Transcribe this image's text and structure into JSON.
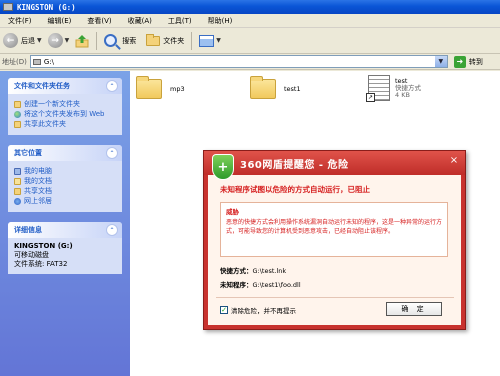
{
  "window": {
    "title": "KINGSTON (G:)"
  },
  "menu": [
    "文件(F)",
    "编辑(E)",
    "查看(V)",
    "收藏(A)",
    "工具(T)",
    "帮助(H)"
  ],
  "toolbar": {
    "back_label": "后退",
    "search_label": "搜索",
    "folders_label": "文件夹"
  },
  "address": {
    "label": "地址(D)",
    "value": "G:\\",
    "go_label": "转到"
  },
  "left_pane": {
    "file_tasks": {
      "title": "文件和文件夹任务",
      "items": [
        "创建一个新文件夹",
        "将这个文件夹发布到 Web",
        "共享此文件夹"
      ]
    },
    "other_places": {
      "title": "其它位置",
      "items": [
        "我的电脑",
        "我的文档",
        "共享文档",
        "网上邻居"
      ]
    },
    "details": {
      "title": "详细信息",
      "name": "KINGSTON (G:)",
      "type": "可移动磁盘",
      "fs": "文件系统: FAT32"
    }
  },
  "files": [
    {
      "name": "mp3",
      "kind": "folder"
    },
    {
      "name": "test1",
      "kind": "folder"
    },
    {
      "name": "test",
      "type": "快捷方式",
      "size": "4 KB",
      "kind": "shortcut"
    }
  ],
  "dialog": {
    "title": "360网盾提醒您 - 危险",
    "close": "×",
    "warning": "未知程序试图以危险的方式自动运行，已阻止",
    "threat_title": "威胁",
    "threat_desc": "恶意的快捷方式会利用操作系统漏洞自动运行未知的程序，这是一种异常的运行方式，可能导致您的计算机受到恶意攻击，已经自动阻止该程序。",
    "shortcut_label": "快捷方式：",
    "shortcut_value": "G:\\test.lnk",
    "program_label": "未知程序：",
    "program_value": "G:\\test1\\foo.dll",
    "checkbox_label": "清除危险，并不再提示",
    "checkbox_checked": true,
    "ok_label": "确 定"
  },
  "colors": {
    "titlebar": "#0a55d6",
    "taskpane": "#6375d6",
    "dialog_red": "#c8322e",
    "warning_red": "#d62020"
  }
}
